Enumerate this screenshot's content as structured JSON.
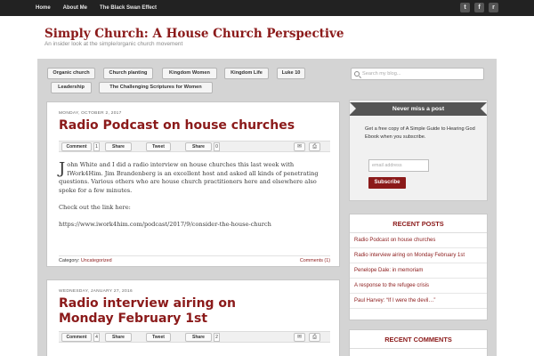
{
  "topnav": {
    "items": [
      "Home",
      "About Me",
      "The Black Swan Effect"
    ],
    "social": [
      {
        "icon": "twitter-icon",
        "glyph": "t"
      },
      {
        "icon": "facebook-icon",
        "glyph": "f"
      },
      {
        "icon": "rss-icon",
        "glyph": "r"
      }
    ]
  },
  "header": {
    "title": "Simply Church: A House Church Perspective",
    "description": "An insider look at the simple/organic church movement"
  },
  "tags": [
    "Organic church",
    "Church planting",
    "Kingdom Women",
    "Kingdom Life",
    "Luke 10",
    "Leadership",
    "The Challenging Scriptures for Women"
  ],
  "search": {
    "placeholder": "Search my blog..."
  },
  "posts": [
    {
      "date": "MONDAY, OCTOBER 2, 2017",
      "title": "Radio Podcast on house churches",
      "share": {
        "comment": "Comment",
        "comment_count": "1",
        "facebook": "Share",
        "tweet": "Tweet",
        "linkedin": "Share",
        "linkedin_count": "0"
      },
      "dropcap": "J",
      "body": [
        "ohn White and I did a radio interview on house churches this last week with IWork4Him. Jim Brandenberg is an excellent host and asked all kinds of penetrating questions. Various others who are house church practitioners here and elsewhere also spoke for a few minutes.",
        "Check out the link here:",
        "https://www.iwork4him.com/podcast/2017/9/consider-the-house-church"
      ],
      "category_label": "Category:",
      "category": "Uncategorized",
      "comments": "Comments (1)"
    },
    {
      "date": "WEDNESDAY, JANUARY 27, 2016",
      "title": "Radio interview airing on Monday February 1st",
      "share": {
        "comment": "Comment",
        "comment_count": "4",
        "facebook": "Share",
        "tweet": "Tweet",
        "linkedin": "Share",
        "linkedin_count": "2"
      }
    }
  ],
  "subscribe": {
    "title": "Never miss a post",
    "text": "Get a free copy of A Simple Guide to Hearing God Ebook when you subscribe.",
    "email_placeholder": "email address",
    "button": "Subscribe"
  },
  "recent_posts": {
    "title": "RECENT POSTS",
    "items": [
      "Radio Podcast on house churches",
      "Radio interview airing on Monday February 1st",
      "Penelope Dale: in memoriam",
      "A response to the refugee crisis",
      "Paul Harvey: “If I were the devil…”"
    ]
  },
  "recent_comments": {
    "title": "RECENT COMMENTS"
  },
  "colors": {
    "accent": "#8b1a1a",
    "topbar": "#222222",
    "panel": "#d4d4d4"
  }
}
